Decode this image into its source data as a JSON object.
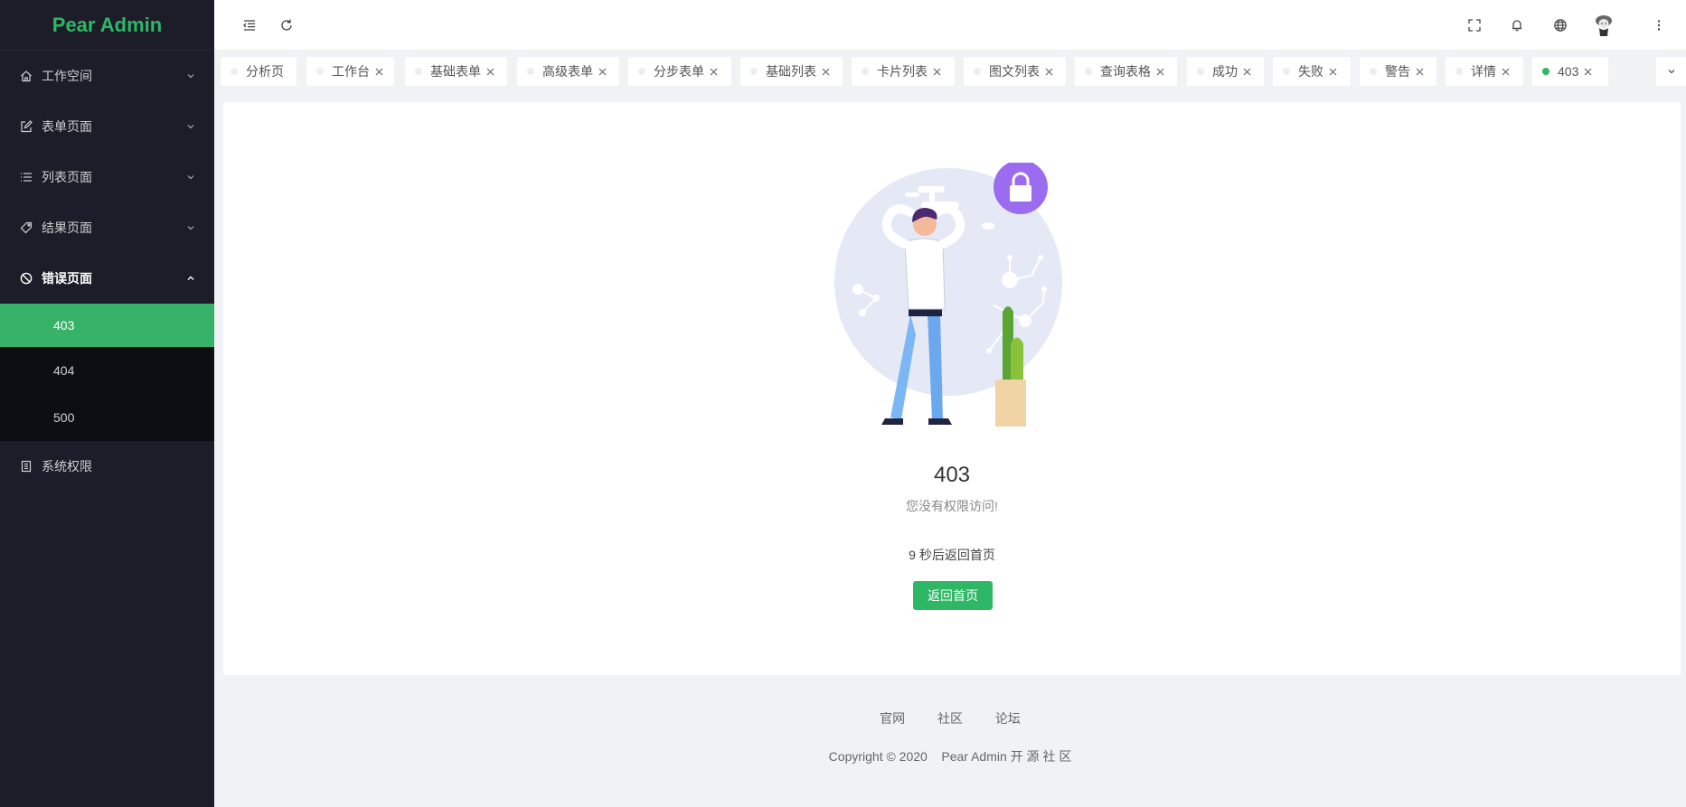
{
  "brand": {
    "title": "Pear Admin",
    "color": "#2eb866"
  },
  "sidebar": {
    "items": [
      {
        "label": "工作空间",
        "icon": "home-icon"
      },
      {
        "label": "表单页面",
        "icon": "edit-icon"
      },
      {
        "label": "列表页面",
        "icon": "list-icon"
      },
      {
        "label": "结果页面",
        "icon": "tag-icon"
      },
      {
        "label": "错误页面",
        "icon": "forbidden-icon",
        "open": true
      },
      {
        "label": "系统权限",
        "icon": "document-icon"
      }
    ],
    "error_children": [
      "403",
      "404",
      "500"
    ],
    "active_child": "403",
    "active_color": "#36b368",
    "bg_color": "#1c1d28"
  },
  "header": {
    "left_icons": [
      "menu-collapse-icon",
      "refresh-icon"
    ],
    "right_icons": [
      "fullscreen-icon",
      "bell-icon",
      "globe-icon",
      "avatar",
      "more-vertical-icon"
    ]
  },
  "tabs": [
    {
      "label": "分析页",
      "closable": false
    },
    {
      "label": "工作台",
      "closable": true
    },
    {
      "label": "基础表单",
      "closable": true
    },
    {
      "label": "高级表单",
      "closable": true
    },
    {
      "label": "分步表单",
      "closable": true
    },
    {
      "label": "基础列表",
      "closable": true
    },
    {
      "label": "卡片列表",
      "closable": true
    },
    {
      "label": "图文列表",
      "closable": true
    },
    {
      "label": "查询表格",
      "closable": true
    },
    {
      "label": "成功",
      "closable": true
    },
    {
      "label": "失败",
      "closable": true
    },
    {
      "label": "警告",
      "closable": true
    },
    {
      "label": "详情",
      "closable": true
    },
    {
      "label": "403",
      "closable": true,
      "active": true
    }
  ],
  "main": {
    "code": "403",
    "message": "您没有权限访问!",
    "countdown": "9 秒后返回首页",
    "button_label": "返回首页"
  },
  "footer": {
    "links": [
      "官网",
      "社区",
      "论坛"
    ],
    "copyright": "Copyright © 2020    Pear Admin 开 源 社 区"
  }
}
